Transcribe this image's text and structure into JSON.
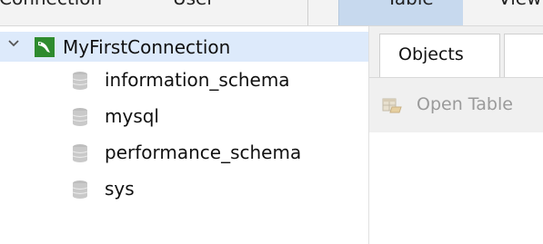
{
  "topbar": {
    "connection_label": "Connection",
    "user_label": "User",
    "table_label": "Table",
    "view_label": "View"
  },
  "tree": {
    "connection": {
      "label": "MyFirstConnection",
      "icon": "dolphin-icon",
      "expanded": true
    },
    "databases": [
      {
        "label": "information_schema",
        "icon": "database-icon"
      },
      {
        "label": "mysql",
        "icon": "database-icon"
      },
      {
        "label": "performance_schema",
        "icon": "database-icon"
      },
      {
        "label": "sys",
        "icon": "database-icon"
      }
    ]
  },
  "right_panel": {
    "tabs": [
      {
        "label": "Objects"
      }
    ],
    "toolbar": {
      "open_table_label": "Open Table"
    }
  },
  "colors": {
    "selected_row": "#ddeafb",
    "toolbar_highlight": "#c7d9ee",
    "connection_icon_green": "#2e8b2e",
    "disabled_text": "#9a9a9a"
  }
}
